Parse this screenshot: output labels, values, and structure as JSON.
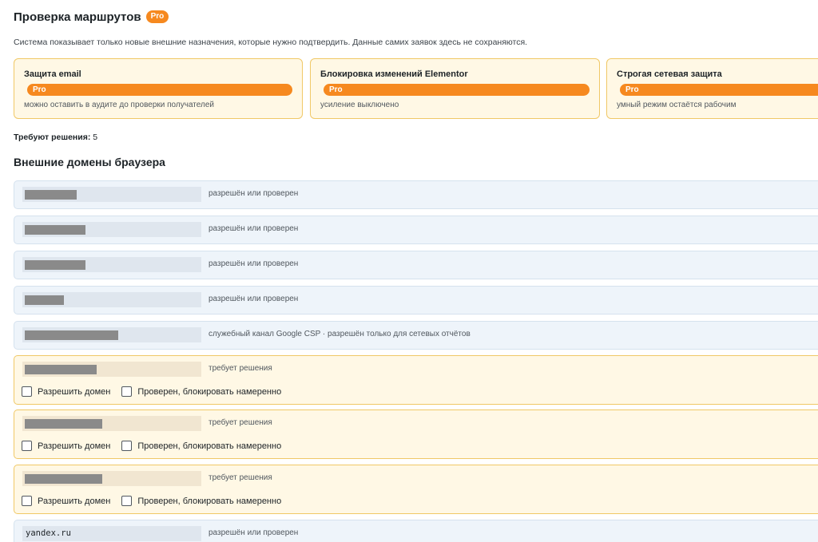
{
  "header": {
    "title": "Проверка маршрутов",
    "badge": "Pro",
    "description": "Система показывает только новые внешние назначения, которые нужно подтвердить. Данные самих заявок здесь не сохраняются."
  },
  "cards": [
    {
      "title": "Защита email",
      "badge": "Pro",
      "note": "можно оставить в аудите до проверки получателей"
    },
    {
      "title": "Блокировка изменений Elementor",
      "badge": "Pro",
      "note": "усиление выключено"
    },
    {
      "title": "Строгая сетевая защита",
      "badge": "Pro",
      "note": "умный режим остаётся рабочим"
    }
  ],
  "summary": {
    "label": "Требуют решения:",
    "value": "5"
  },
  "section_title": "Внешние домены браузера",
  "domains": [
    {
      "status": "разрешён или проверен"
    },
    {
      "status": "разрешён или проверен"
    },
    {
      "status": "разрешён или проверен"
    },
    {
      "status": "разрешён или проверен"
    },
    {
      "status": "служебный канал Google CSP · разрешён только для сетевых отчётов"
    },
    {
      "status": "требует решения",
      "allow_label": "Разрешить домен",
      "block_label": "Проверен, блокировать намеренно"
    },
    {
      "status": "требует решения",
      "allow_label": "Разрешить домен",
      "block_label": "Проверен, блокировать намеренно"
    },
    {
      "status": "требует решения",
      "allow_label": "Разрешить домен",
      "block_label": "Проверен, блокировать намеренно"
    },
    {
      "name": "yandex.ru",
      "status": "разрешён или проверен"
    }
  ],
  "colors": {
    "accent": "#f6891f",
    "pending_bg": "#fff8e5",
    "ok_bg": "#eef4fa"
  }
}
